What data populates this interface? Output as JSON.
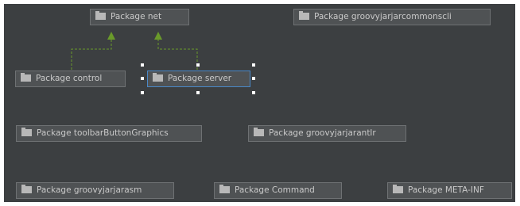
{
  "diagram": {
    "packages": {
      "net": "Package net",
      "groovyjarjarcommonscli": "Package groovyjarjarcommonscli",
      "control": "Package control",
      "server": "Package server",
      "toolbarButtonGraphics": "Package toolbarButtonGraphics",
      "groovyjarjarantlr": "Package groovyjarjarantlr",
      "groovyjarjarasm": "Package groovyjarjarasm",
      "command": "Package Command",
      "metainf": "Package META-INF"
    },
    "selected": "server",
    "colors": {
      "canvas": "#3c3f41",
      "box": "#4f5254",
      "text": "#c9c9c9",
      "edge": "#6a9a2a",
      "selection": "#4a88c7"
    }
  }
}
